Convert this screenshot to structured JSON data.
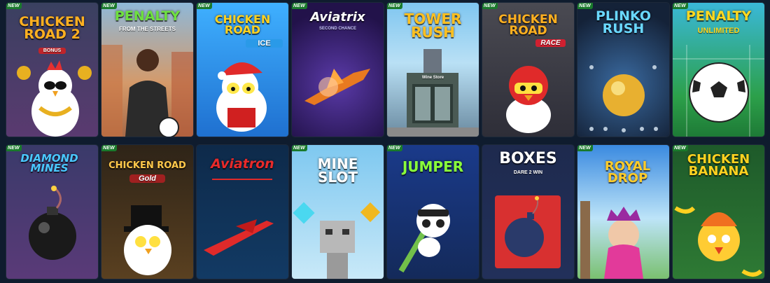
{
  "badge_label": "NEW",
  "games": [
    {
      "title": "CHICKEN ROAD 2",
      "subtitle": "BONUS",
      "new": true
    },
    {
      "title": "PENALTY",
      "subtitle": "FROM THE STREETS",
      "new": true
    },
    {
      "title": "CHICKEN ROAD",
      "subtitle": "ICE",
      "new": true
    },
    {
      "title": "Aviatrix",
      "subtitle": "SECOND CHANCE",
      "new": true
    },
    {
      "title": "TOWER RUSH",
      "subtitle": "Wine Store",
      "new": true
    },
    {
      "title": "CHICKEN ROAD",
      "subtitle": "RACE",
      "new": true
    },
    {
      "title": "PLINKO RUSH",
      "subtitle": "",
      "new": true
    },
    {
      "title": "PENALTY",
      "subtitle": "UNLIMITED",
      "new": true
    },
    {
      "title": "DIAMOND MINES",
      "subtitle": "",
      "new": true
    },
    {
      "title": "CHICKEN ROAD",
      "subtitle": "Gold",
      "new": true
    },
    {
      "title": "Aviatron",
      "subtitle": "",
      "new": false
    },
    {
      "title": "MINE SLOT",
      "subtitle": "",
      "new": true
    },
    {
      "title": "JUMPER",
      "subtitle": "",
      "new": true
    },
    {
      "title": "BOXES",
      "subtitle": "DARE 2 WIN",
      "new": false
    },
    {
      "title": "ROYAL DROP",
      "subtitle": "",
      "new": true
    },
    {
      "title": "CHICKEN BANANA",
      "subtitle": "",
      "new": true
    }
  ],
  "colors": {
    "page_background": "#0f1c2e",
    "badge_background": "#1a7a2c"
  }
}
